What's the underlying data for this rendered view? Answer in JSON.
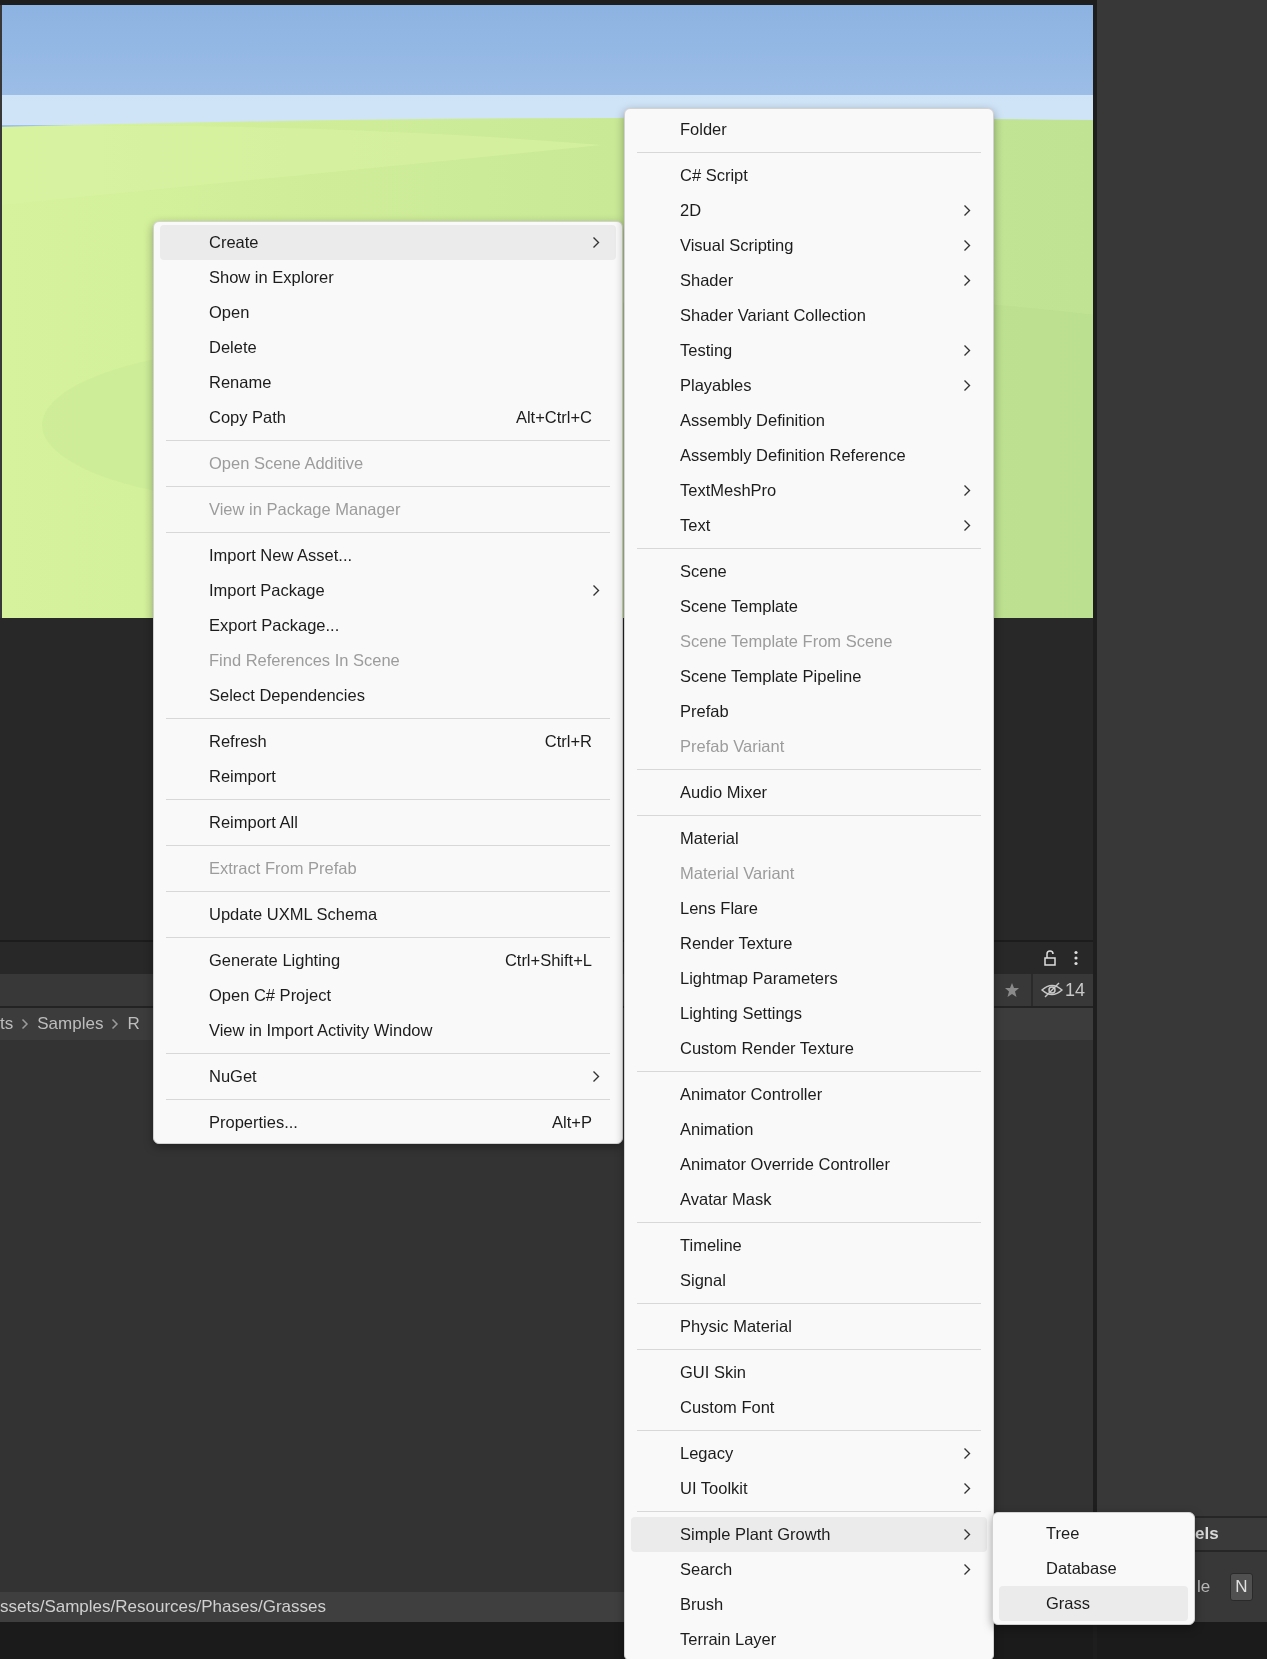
{
  "project_panel": {
    "hidden_count": "14",
    "breadcrumb": [
      "ts",
      "Samples",
      "R"
    ],
    "path": "ssets/Samples/Resources/Phases/Grasses"
  },
  "inspector_panel": {
    "section_label": "els",
    "row_label": "le",
    "field_value": "N"
  },
  "context_menu": {
    "items": [
      {
        "kind": "item",
        "label": "Create",
        "submenu": true,
        "selected": true,
        "disabled": false
      },
      {
        "kind": "item",
        "label": "Show in Explorer",
        "submenu": false,
        "selected": false,
        "disabled": false
      },
      {
        "kind": "item",
        "label": "Open",
        "submenu": false,
        "selected": false,
        "disabled": false
      },
      {
        "kind": "item",
        "label": "Delete",
        "submenu": false,
        "selected": false,
        "disabled": false
      },
      {
        "kind": "item",
        "label": "Rename",
        "submenu": false,
        "selected": false,
        "disabled": false
      },
      {
        "kind": "item",
        "label": "Copy Path",
        "shortcut": "Alt+Ctrl+C",
        "submenu": false,
        "selected": false,
        "disabled": false
      },
      {
        "kind": "separator"
      },
      {
        "kind": "item",
        "label": "Open Scene Additive",
        "submenu": false,
        "selected": false,
        "disabled": true
      },
      {
        "kind": "separator"
      },
      {
        "kind": "item",
        "label": "View in Package Manager",
        "submenu": false,
        "selected": false,
        "disabled": true
      },
      {
        "kind": "separator"
      },
      {
        "kind": "item",
        "label": "Import New Asset...",
        "submenu": false,
        "selected": false,
        "disabled": false
      },
      {
        "kind": "item",
        "label": "Import Package",
        "submenu": true,
        "selected": false,
        "disabled": false
      },
      {
        "kind": "item",
        "label": "Export Package...",
        "submenu": false,
        "selected": false,
        "disabled": false
      },
      {
        "kind": "item",
        "label": "Find References In Scene",
        "submenu": false,
        "selected": false,
        "disabled": true
      },
      {
        "kind": "item",
        "label": "Select Dependencies",
        "submenu": false,
        "selected": false,
        "disabled": false
      },
      {
        "kind": "separator"
      },
      {
        "kind": "item",
        "label": "Refresh",
        "shortcut": "Ctrl+R",
        "submenu": false,
        "selected": false,
        "disabled": false
      },
      {
        "kind": "item",
        "label": "Reimport",
        "submenu": false,
        "selected": false,
        "disabled": false
      },
      {
        "kind": "separator"
      },
      {
        "kind": "item",
        "label": "Reimport All",
        "submenu": false,
        "selected": false,
        "disabled": false
      },
      {
        "kind": "separator"
      },
      {
        "kind": "item",
        "label": "Extract From Prefab",
        "submenu": false,
        "selected": false,
        "disabled": true
      },
      {
        "kind": "separator"
      },
      {
        "kind": "item",
        "label": "Update UXML Schema",
        "submenu": false,
        "selected": false,
        "disabled": false
      },
      {
        "kind": "separator"
      },
      {
        "kind": "item",
        "label": "Generate Lighting",
        "shortcut": "Ctrl+Shift+L",
        "submenu": false,
        "selected": false,
        "disabled": false
      },
      {
        "kind": "item",
        "label": "Open C# Project",
        "submenu": false,
        "selected": false,
        "disabled": false
      },
      {
        "kind": "item",
        "label": "View in Import Activity Window",
        "submenu": false,
        "selected": false,
        "disabled": false
      },
      {
        "kind": "separator"
      },
      {
        "kind": "item",
        "label": "NuGet",
        "submenu": true,
        "selected": false,
        "disabled": false
      },
      {
        "kind": "separator"
      },
      {
        "kind": "item",
        "label": "Properties...",
        "shortcut": "Alt+P",
        "submenu": false,
        "selected": false,
        "disabled": false
      }
    ]
  },
  "create_submenu": {
    "items": [
      {
        "kind": "item",
        "label": "Folder",
        "submenu": false,
        "selected": false,
        "disabled": false
      },
      {
        "kind": "separator"
      },
      {
        "kind": "item",
        "label": "C# Script",
        "submenu": false,
        "selected": false,
        "disabled": false
      },
      {
        "kind": "item",
        "label": "2D",
        "submenu": true,
        "selected": false,
        "disabled": false
      },
      {
        "kind": "item",
        "label": "Visual Scripting",
        "submenu": true,
        "selected": false,
        "disabled": false
      },
      {
        "kind": "item",
        "label": "Shader",
        "submenu": true,
        "selected": false,
        "disabled": false
      },
      {
        "kind": "item",
        "label": "Shader Variant Collection",
        "submenu": false,
        "selected": false,
        "disabled": false
      },
      {
        "kind": "item",
        "label": "Testing",
        "submenu": true,
        "selected": false,
        "disabled": false
      },
      {
        "kind": "item",
        "label": "Playables",
        "submenu": true,
        "selected": false,
        "disabled": false
      },
      {
        "kind": "item",
        "label": "Assembly Definition",
        "submenu": false,
        "selected": false,
        "disabled": false
      },
      {
        "kind": "item",
        "label": "Assembly Definition Reference",
        "submenu": false,
        "selected": false,
        "disabled": false
      },
      {
        "kind": "item",
        "label": "TextMeshPro",
        "submenu": true,
        "selected": false,
        "disabled": false
      },
      {
        "kind": "item",
        "label": "Text",
        "submenu": true,
        "selected": false,
        "disabled": false
      },
      {
        "kind": "separator"
      },
      {
        "kind": "item",
        "label": "Scene",
        "submenu": false,
        "selected": false,
        "disabled": false
      },
      {
        "kind": "item",
        "label": "Scene Template",
        "submenu": false,
        "selected": false,
        "disabled": false
      },
      {
        "kind": "item",
        "label": "Scene Template From Scene",
        "submenu": false,
        "selected": false,
        "disabled": true
      },
      {
        "kind": "item",
        "label": "Scene Template Pipeline",
        "submenu": false,
        "selected": false,
        "disabled": false
      },
      {
        "kind": "item",
        "label": "Prefab",
        "submenu": false,
        "selected": false,
        "disabled": false
      },
      {
        "kind": "item",
        "label": "Prefab Variant",
        "submenu": false,
        "selected": false,
        "disabled": true
      },
      {
        "kind": "separator"
      },
      {
        "kind": "item",
        "label": "Audio Mixer",
        "submenu": false,
        "selected": false,
        "disabled": false
      },
      {
        "kind": "separator"
      },
      {
        "kind": "item",
        "label": "Material",
        "submenu": false,
        "selected": false,
        "disabled": false
      },
      {
        "kind": "item",
        "label": "Material Variant",
        "submenu": false,
        "selected": false,
        "disabled": true
      },
      {
        "kind": "item",
        "label": "Lens Flare",
        "submenu": false,
        "selected": false,
        "disabled": false
      },
      {
        "kind": "item",
        "label": "Render Texture",
        "submenu": false,
        "selected": false,
        "disabled": false
      },
      {
        "kind": "item",
        "label": "Lightmap Parameters",
        "submenu": false,
        "selected": false,
        "disabled": false
      },
      {
        "kind": "item",
        "label": "Lighting Settings",
        "submenu": false,
        "selected": false,
        "disabled": false
      },
      {
        "kind": "item",
        "label": "Custom Render Texture",
        "submenu": false,
        "selected": false,
        "disabled": false
      },
      {
        "kind": "separator"
      },
      {
        "kind": "item",
        "label": "Animator Controller",
        "submenu": false,
        "selected": false,
        "disabled": false
      },
      {
        "kind": "item",
        "label": "Animation",
        "submenu": false,
        "selected": false,
        "disabled": false
      },
      {
        "kind": "item",
        "label": "Animator Override Controller",
        "submenu": false,
        "selected": false,
        "disabled": false
      },
      {
        "kind": "item",
        "label": "Avatar Mask",
        "submenu": false,
        "selected": false,
        "disabled": false
      },
      {
        "kind": "separator"
      },
      {
        "kind": "item",
        "label": "Timeline",
        "submenu": false,
        "selected": false,
        "disabled": false
      },
      {
        "kind": "item",
        "label": "Signal",
        "submenu": false,
        "selected": false,
        "disabled": false
      },
      {
        "kind": "separator"
      },
      {
        "kind": "item",
        "label": "Physic Material",
        "submenu": false,
        "selected": false,
        "disabled": false
      },
      {
        "kind": "separator"
      },
      {
        "kind": "item",
        "label": "GUI Skin",
        "submenu": false,
        "selected": false,
        "disabled": false
      },
      {
        "kind": "item",
        "label": "Custom Font",
        "submenu": false,
        "selected": false,
        "disabled": false
      },
      {
        "kind": "separator"
      },
      {
        "kind": "item",
        "label": "Legacy",
        "submenu": true,
        "selected": false,
        "disabled": false
      },
      {
        "kind": "item",
        "label": "UI Toolkit",
        "submenu": true,
        "selected": false,
        "disabled": false
      },
      {
        "kind": "separator"
      },
      {
        "kind": "item",
        "label": "Simple Plant Growth",
        "submenu": true,
        "selected": true,
        "disabled": false
      },
      {
        "kind": "item",
        "label": "Search",
        "submenu": true,
        "selected": false,
        "disabled": false
      },
      {
        "kind": "item",
        "label": "Brush",
        "submenu": false,
        "selected": false,
        "disabled": false
      },
      {
        "kind": "item",
        "label": "Terrain Layer",
        "submenu": false,
        "selected": false,
        "disabled": false
      }
    ]
  },
  "plant_submenu": {
    "items": [
      {
        "kind": "item",
        "label": "Tree",
        "submenu": false,
        "selected": false,
        "disabled": false
      },
      {
        "kind": "item",
        "label": "Database",
        "submenu": false,
        "selected": false,
        "disabled": false
      },
      {
        "kind": "item",
        "label": "Grass",
        "submenu": false,
        "selected": true,
        "disabled": false
      }
    ]
  }
}
